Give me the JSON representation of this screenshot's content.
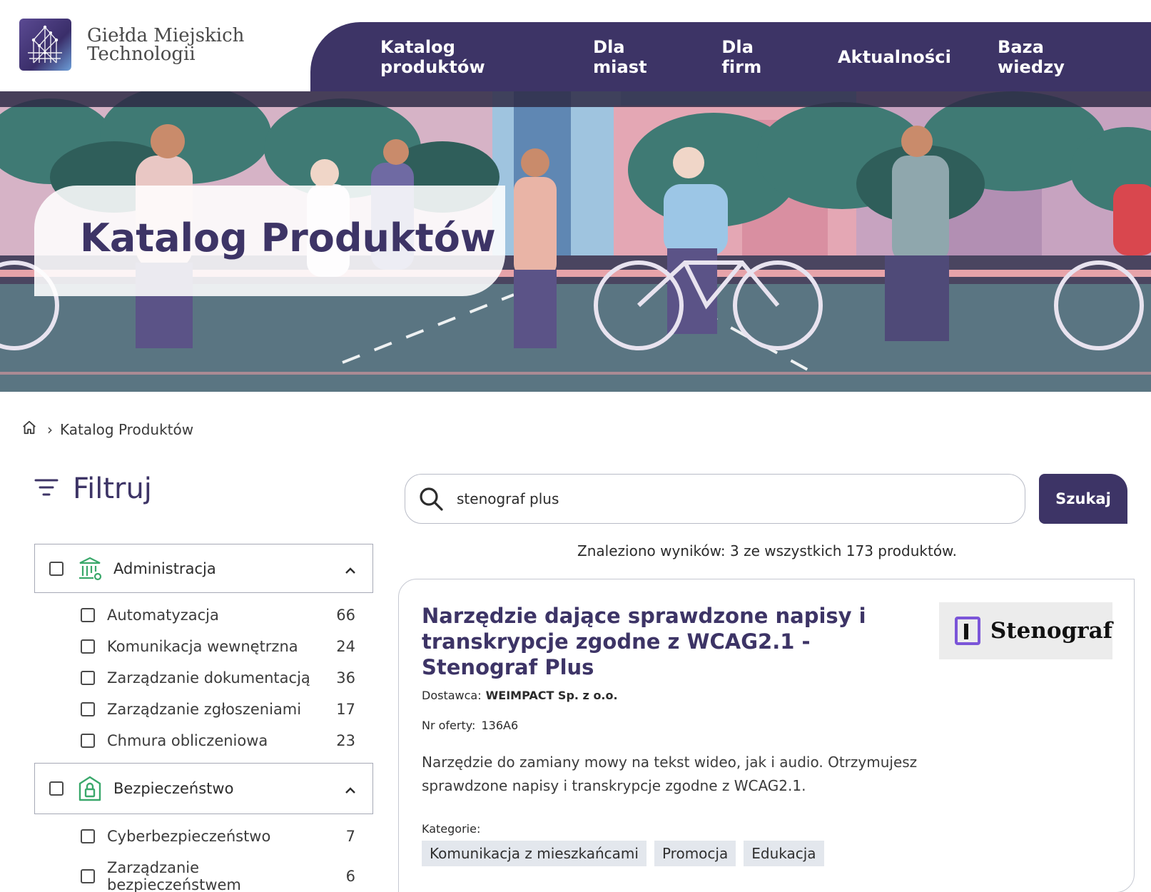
{
  "header": {
    "logo_line1": "Giełda Miejskich",
    "logo_line2": "Technologii",
    "nav": [
      "Katalog produktów",
      "Dla miast",
      "Dla firm",
      "Aktualności",
      "Baza wiedzy"
    ]
  },
  "hero": {
    "title": "Katalog Produktów"
  },
  "breadcrumb": {
    "current": "Katalog Produktów"
  },
  "filter": {
    "title": "Filtruj",
    "groups": [
      {
        "label": "Administracja",
        "items": [
          {
            "label": "Automatyzacja",
            "count": "66"
          },
          {
            "label": "Komunikacja wewnętrzna",
            "count": "24"
          },
          {
            "label": "Zarządzanie dokumentacją",
            "count": "36"
          },
          {
            "label": "Zarządzanie zgłoszeniami",
            "count": "17"
          },
          {
            "label": "Chmura obliczeniowa",
            "count": "23"
          }
        ]
      },
      {
        "label": "Bezpieczeństwo",
        "items": [
          {
            "label": "Cyberbezpieczeństwo",
            "count": "7"
          },
          {
            "label": "Zarządzanie bezpieczeństwem",
            "count": "6"
          }
        ]
      }
    ]
  },
  "search": {
    "value": "stenograf plus",
    "button_label": "Szukaj"
  },
  "results": {
    "summary": "Znaleziono wyników: 3 ze wszystkich 173 produktów."
  },
  "product": {
    "title": "Narzędzie dające sprawdzone napisy i transkrypcje zgodne z WCAG2.1 - Stenograf Plus",
    "logo_text": "Stenograf",
    "supplier_label": "Dostawca:",
    "supplier_value": "WEIMPACT Sp. z o.o.",
    "offer_label": "Nr oferty:",
    "offer_value": "136A6",
    "description": "Narzędzie do zamiany mowy na tekst wideo, jak i audio. Otrzymujesz sprawdzone napisy i transkrypcje zgodne z WCAG2.1.",
    "categories_label": "Kategorie:",
    "categories": [
      "Komunikacja z mieszkańcami",
      "Promocja",
      "Edukacja"
    ]
  },
  "colors": {
    "primary": "#3d3466",
    "accent_green": "#3aa86b",
    "tag_bg": "#e3e7ed"
  }
}
